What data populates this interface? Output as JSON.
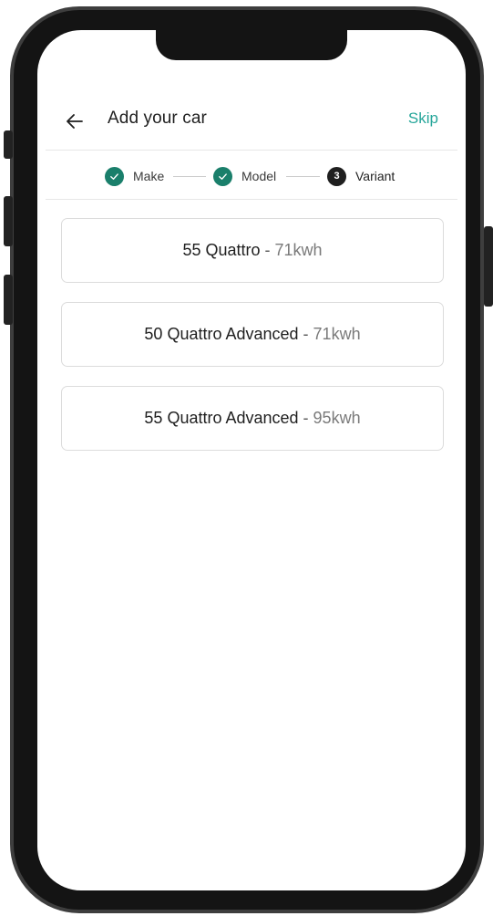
{
  "header": {
    "title": "Add your car",
    "skip_label": "Skip",
    "back_icon": "arrow-left-icon"
  },
  "stepper": {
    "steps": [
      {
        "label": "Make",
        "state": "done",
        "icon": "check-icon"
      },
      {
        "label": "Model",
        "state": "done",
        "icon": "check-icon"
      },
      {
        "label": "Variant",
        "state": "current",
        "number": "3"
      }
    ]
  },
  "variants": [
    {
      "name": "55 Quattro",
      "separator": " - ",
      "spec": "71kwh"
    },
    {
      "name": "50 Quattro Advanced",
      "separator": " - ",
      "spec": "71kwh"
    },
    {
      "name": "55 Quattro Advanced",
      "separator": " - ",
      "spec": "95kwh"
    }
  ],
  "colors": {
    "accent": "#26a69a",
    "step_done": "#1a7f6b",
    "step_current": "#1f1f1f"
  }
}
